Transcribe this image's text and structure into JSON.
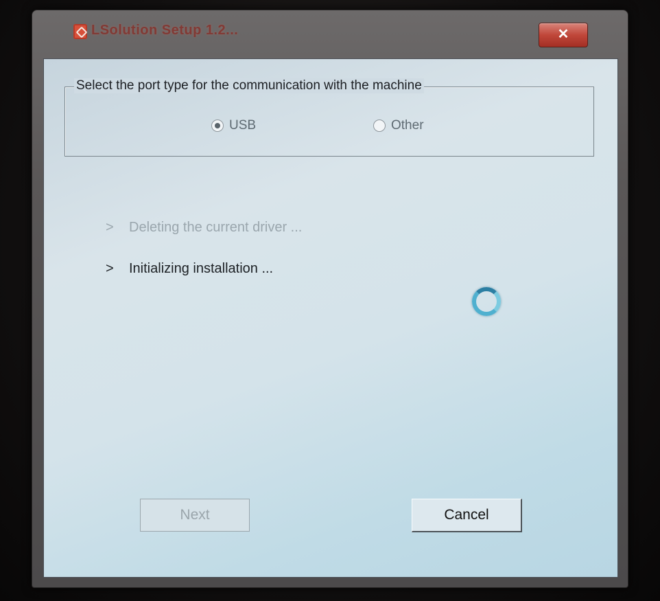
{
  "window": {
    "title": "LSolution Setup 1.2...",
    "close_label": "✕"
  },
  "port_group": {
    "legend": "Select the port type for the communication with the machine",
    "options": [
      {
        "label": "USB",
        "selected": true
      },
      {
        "label": "Other",
        "selected": false
      }
    ]
  },
  "steps": [
    {
      "arrow": ">",
      "label": "Deleting the current driver ...",
      "state": "done"
    },
    {
      "arrow": ">",
      "label": "Initializing installation ...",
      "state": "active"
    }
  ],
  "buttons": {
    "next_label": "Next",
    "next_enabled": false,
    "cancel_label": "Cancel"
  },
  "status": {
    "busy_icon": "spinner-icon"
  },
  "colors": {
    "titlebar": "#5a5757",
    "client_bg": "#d4e3ea",
    "close_button": "#c0473a",
    "spinner": "#4fb0cf"
  }
}
